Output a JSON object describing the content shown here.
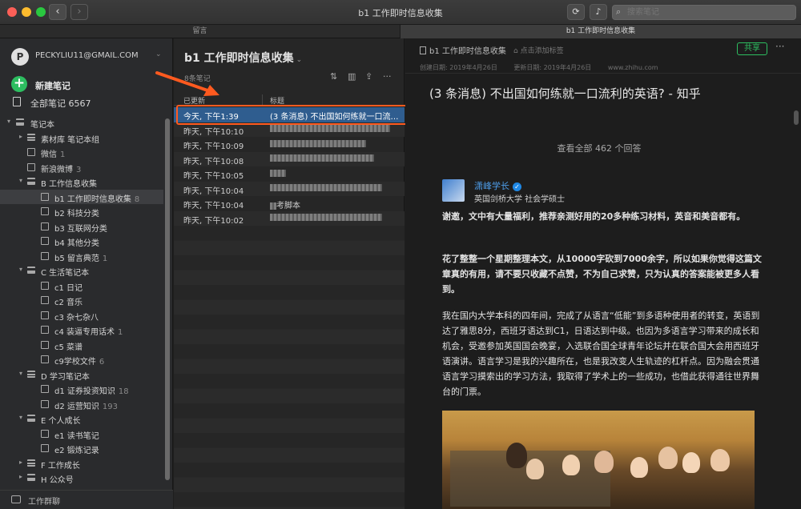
{
  "window": {
    "title": "b1 工作即时信息收集"
  },
  "search": {
    "placeholder": "搜索笔记"
  },
  "tabs": [
    {
      "label": "留言"
    },
    {
      "label": "b1 工作即时信息收集"
    }
  ],
  "sidebar": {
    "account": "PECKYLIU11@GMAIL.COM",
    "avatar_letter": "P",
    "new_note": "新建笔记",
    "all_notes": "全部笔记",
    "all_notes_count": "6567",
    "footer": "工作群聊",
    "tree": [
      {
        "label": "笔记本",
        "count": "",
        "level": 0,
        "arrow": "▾",
        "stack": true
      },
      {
        "label": "素材库 笔记本组",
        "count": "",
        "level": 1,
        "arrow": "▸",
        "stack": true
      },
      {
        "label": "微信",
        "count": "1",
        "level": 1,
        "arrow": "",
        "stack": false
      },
      {
        "label": "新浪微博",
        "count": "3",
        "level": 1,
        "arrow": "",
        "stack": false
      },
      {
        "label": "B 工作信息收集",
        "count": "",
        "level": 1,
        "arrow": "▾",
        "stack": true
      },
      {
        "label": "b1 工作即时信息收集",
        "count": "8",
        "level": 2,
        "arrow": "",
        "stack": false,
        "selected": true
      },
      {
        "label": "b2 科技分类",
        "count": "",
        "level": 2,
        "arrow": "",
        "stack": false
      },
      {
        "label": "b3 互联网分类",
        "count": "",
        "level": 2,
        "arrow": "",
        "stack": false
      },
      {
        "label": "b4 其他分类",
        "count": "",
        "level": 2,
        "arrow": "",
        "stack": false
      },
      {
        "label": "b5 留言典范",
        "count": "1",
        "level": 2,
        "arrow": "",
        "stack": false
      },
      {
        "label": "C 生活笔记本",
        "count": "",
        "level": 1,
        "arrow": "▾",
        "stack": true
      },
      {
        "label": "c1 日记",
        "count": "",
        "level": 2,
        "arrow": "",
        "stack": false
      },
      {
        "label": "c2 音乐",
        "count": "",
        "level": 2,
        "arrow": "",
        "stack": false
      },
      {
        "label": "c3 杂七杂八",
        "count": "",
        "level": 2,
        "arrow": "",
        "stack": false
      },
      {
        "label": "c4 装逼专用话术",
        "count": "1",
        "level": 2,
        "arrow": "",
        "stack": false
      },
      {
        "label": "c5 菜谱",
        "count": "",
        "level": 2,
        "arrow": "",
        "stack": false
      },
      {
        "label": "c9学校文件",
        "count": "6",
        "level": 2,
        "arrow": "",
        "stack": false
      },
      {
        "label": "D 学习笔记本",
        "count": "",
        "level": 1,
        "arrow": "▾",
        "stack": true
      },
      {
        "label": "d1 证券投资知识",
        "count": "18",
        "level": 2,
        "arrow": "",
        "stack": false
      },
      {
        "label": "d2 运营知识",
        "count": "193",
        "level": 2,
        "arrow": "",
        "stack": false
      },
      {
        "label": "E 个人成长",
        "count": "",
        "level": 1,
        "arrow": "▾",
        "stack": true
      },
      {
        "label": "e1 读书笔记",
        "count": "",
        "level": 2,
        "arrow": "",
        "stack": false
      },
      {
        "label": "e2 锻炼记录",
        "count": "",
        "level": 2,
        "arrow": "",
        "stack": false
      },
      {
        "label": "F 工作成长",
        "count": "",
        "level": 1,
        "arrow": "▸",
        "stack": true
      },
      {
        "label": "H 公众号",
        "count": "",
        "level": 1,
        "arrow": "▸",
        "stack": true
      }
    ]
  },
  "notelist": {
    "title": "b1 工作即时信息收集",
    "count_label": "8条笔记",
    "col_updated": "已更新",
    "col_title": "标题",
    "rows": [
      {
        "date": "今天, 下午1:39",
        "title": "(3 条消息) 不出国如何练就一口流利的英语? - 知乎",
        "selected": true,
        "blur": 0
      },
      {
        "date": "昨天, 下午10:10",
        "title": "",
        "blur": 150
      },
      {
        "date": "昨天, 下午10:09",
        "title": "",
        "blur": 120
      },
      {
        "date": "昨天, 下午10:08",
        "title": "",
        "blur": 130
      },
      {
        "date": "昨天, 下午10:05",
        "title": "",
        "blur": 20
      },
      {
        "date": "昨天, 下午10:04",
        "title": "",
        "blur": 140
      },
      {
        "date": "昨天, 下午10:04",
        "title": "考脚本",
        "blur": 8
      },
      {
        "date": "昨天, 下午10:02",
        "title": "",
        "blur": 140
      }
    ]
  },
  "note": {
    "notebook": "b1 工作即时信息收集",
    "tag_placeholder": "点击添加标签",
    "share": "共享",
    "created": "创建日期: 2019年4月26日",
    "updated": "更新日期: 2019年4月26日",
    "url": "www.zhihu.com",
    "title": "(3 条消息) 不出国如何练就一口流利的英语? - 知乎",
    "view_all": "查看全部 462 个回答",
    "author_name": "潇峰学长",
    "author_title": "英国剑桥大学 社会学硕士",
    "p1": "谢邀，文中有大量福利，推荐亲测好用的20多种练习材料，英音和美音都有。",
    "p2": "花了整整一个星期整理本文，从10000字砍到7000余字，所以如果你觉得这篇文章真的有用，请不要只收藏不点赞，不为自己求赞，只为认真的答案能被更多人看到。",
    "p3": "我在国内大学本科的四年间，完成了从语言“低能”到多语种使用者的转变，英语到达了雅思8分，西班牙语达到C1，日语达到中级。也因为多语言学习带来的成长和机会，受邀参加英国国会晚宴，入选联合国全球青年论坛并在联合国大会用西班牙语演讲。语言学习是我的兴趣所在，也是我改变人生轨迹的杠杆点。因为融会贯通语言学习摸索出的学习方法，我取得了学术上的一些成功，也借此获得通往世界舞台的门票。"
  },
  "colors": {
    "accent_green": "#2dbe60",
    "selection_blue": "#2f5d8f",
    "highlight_orange": "#ff5a1f",
    "link_blue": "#4d9be6"
  }
}
